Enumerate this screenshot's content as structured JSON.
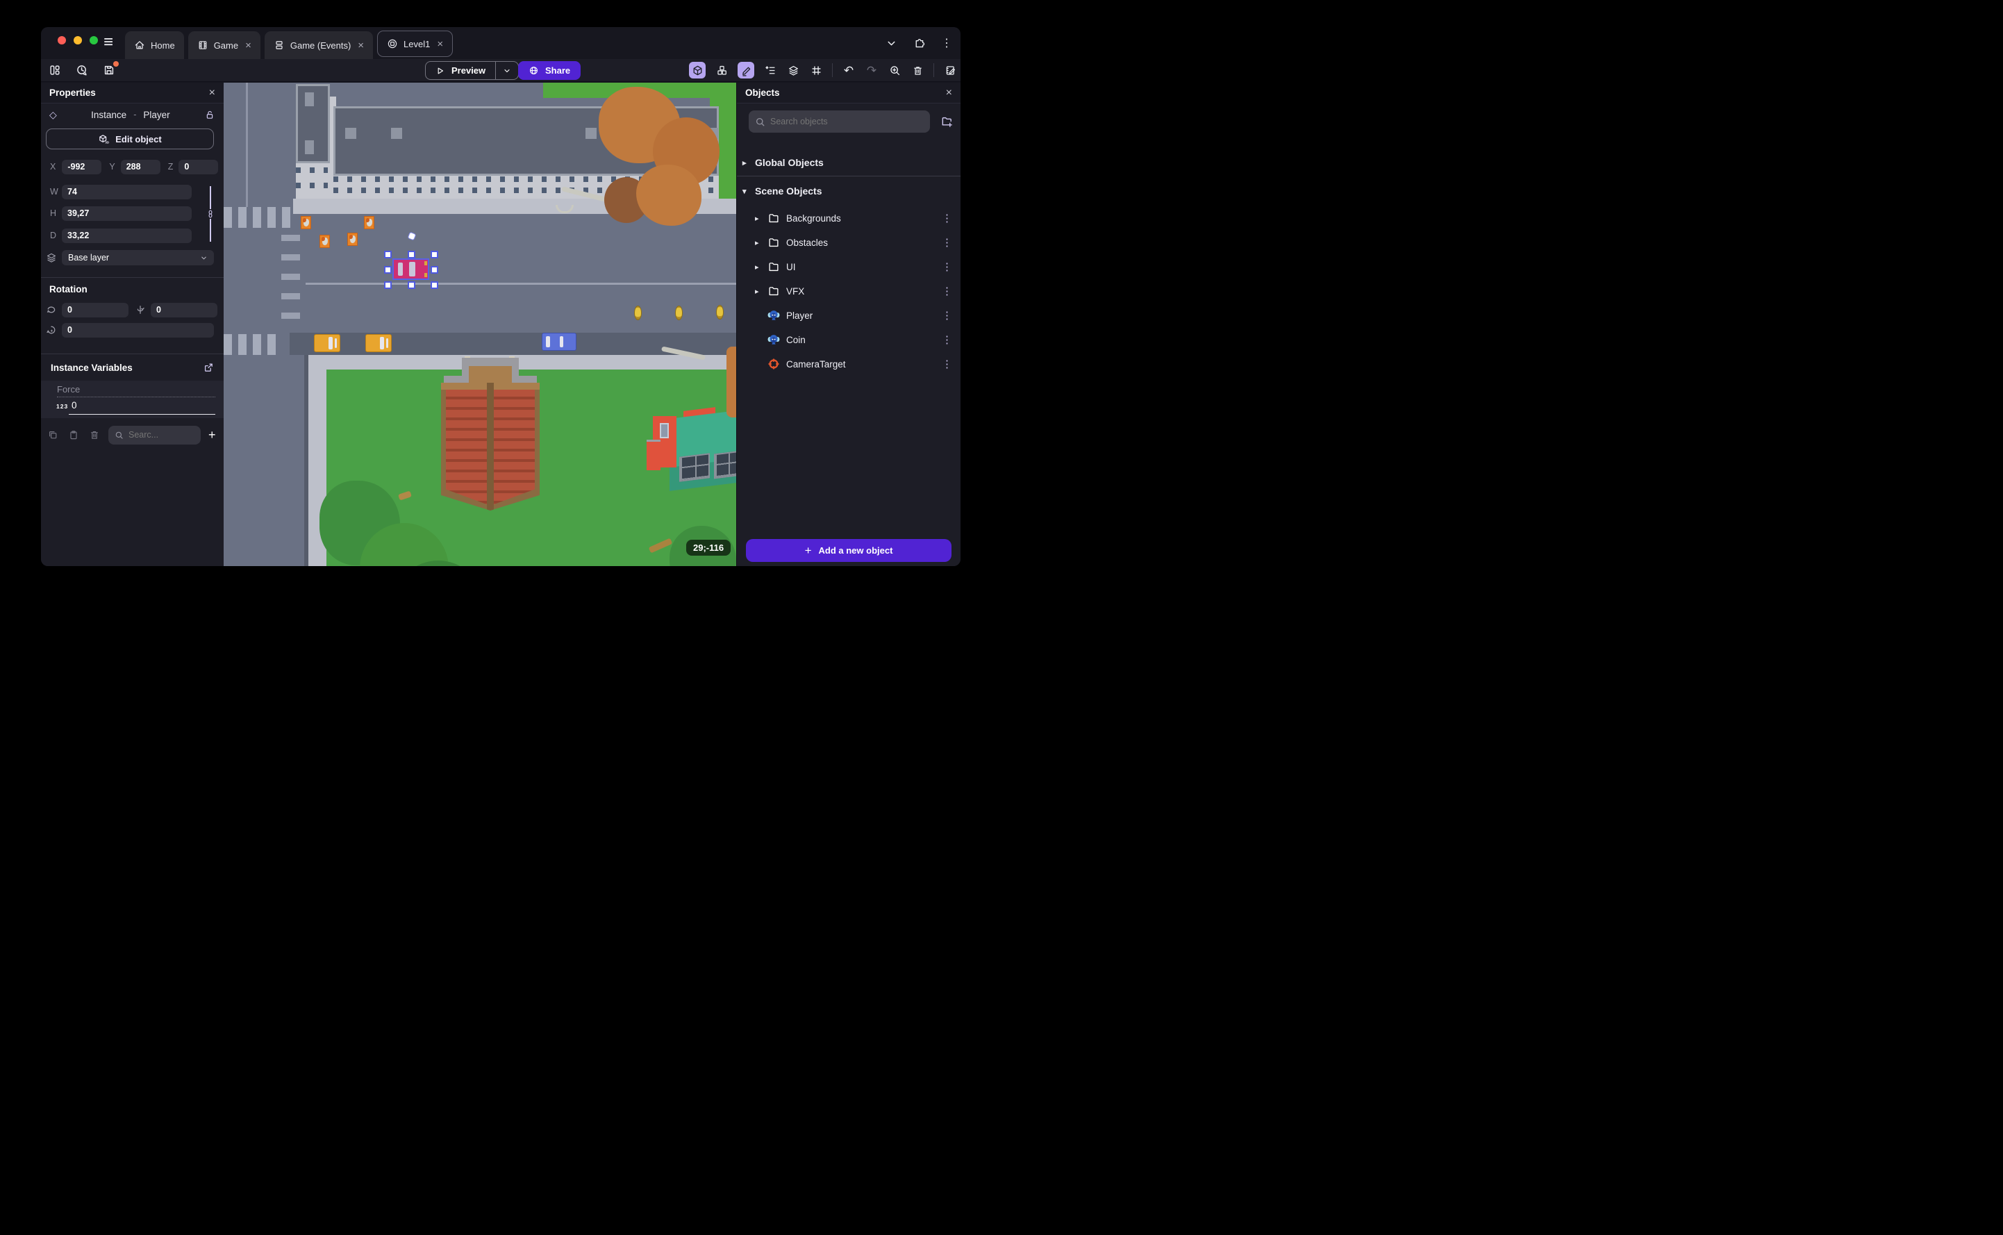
{
  "titlebar": {
    "tabs": [
      {
        "label": "Home"
      },
      {
        "label": "Game"
      },
      {
        "label": "Game (Events)"
      },
      {
        "label": "Level1"
      }
    ]
  },
  "toolbar": {
    "preview": "Preview",
    "share": "Share"
  },
  "glyphs": {
    "close": "×",
    "kebab": "⋮",
    "chevron_right": "▸",
    "chevron_down": "▾",
    "plus": "+",
    "diamond": "◇",
    "undo": "↶",
    "redo": "↷",
    "hamburger": "≡"
  },
  "properties": {
    "title": "Properties",
    "instance_label": "Instance",
    "separator": "-",
    "instance_name": "Player",
    "edit_object": "Edit object",
    "coords": {
      "x_label": "X",
      "x": "-992",
      "y_label": "Y",
      "y": "288",
      "z_label": "Z",
      "z": "0"
    },
    "size": {
      "w_label": "W",
      "w": "74",
      "h_label": "H",
      "h": "39,27",
      "d_label": "D",
      "d": "33,22"
    },
    "layer": "Base layer",
    "rotation": {
      "title": "Rotation",
      "x": "0",
      "y": "0",
      "z": "0"
    },
    "variables": {
      "title": "Instance Variables",
      "name": "Force",
      "type_badge": "123",
      "value": "0",
      "search_placeholder": "Searc..."
    }
  },
  "objects_panel": {
    "title": "Objects",
    "search_placeholder": "Search objects",
    "global_group": "Global Objects",
    "scene_group": "Scene Objects",
    "items": [
      {
        "label": "Backgrounds",
        "kind": "folder"
      },
      {
        "label": "Obstacles",
        "kind": "folder"
      },
      {
        "label": "UI",
        "kind": "folder"
      },
      {
        "label": "VFX",
        "kind": "folder"
      },
      {
        "label": "Player",
        "kind": "object"
      },
      {
        "label": "Coin",
        "kind": "object"
      },
      {
        "label": "CameraTarget",
        "kind": "camera"
      }
    ],
    "add_button": "Add a new object"
  },
  "canvas": {
    "coordinate_badge": "29;-116"
  },
  "colors": {
    "accent_purple": "#5123d3",
    "active_tool_bg": "#b6a5f0",
    "selection_blue": "#4f5ae0",
    "save_indicator": "#f2734d",
    "road": "#6a7184",
    "road_dark": "#596070",
    "sidewalk": "#bdc0ca",
    "grass": "#4aa147",
    "camera_target_orange": "#e2552c"
  }
}
